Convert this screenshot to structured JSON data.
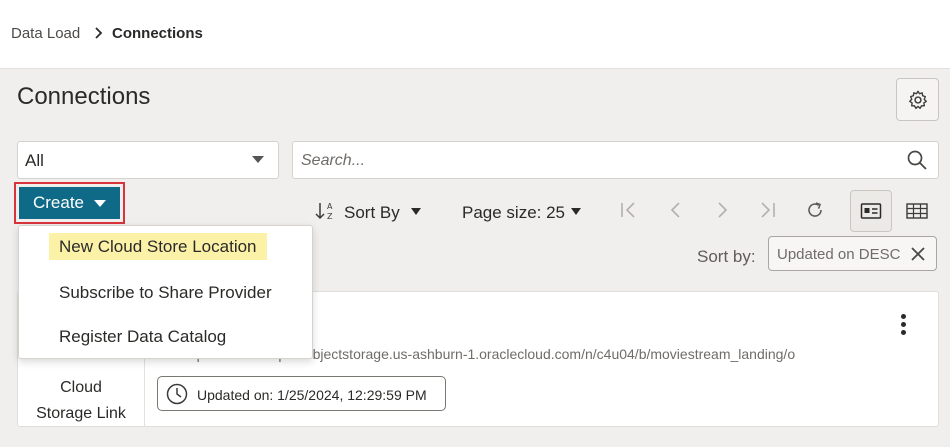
{
  "breadcrumb": {
    "parent": "Data Load",
    "current": "Connections"
  },
  "page": {
    "title": "Connections"
  },
  "filter": {
    "selected": "All"
  },
  "search": {
    "placeholder": "Search..."
  },
  "create": {
    "label": "Create",
    "menu": [
      "New Cloud Store Location",
      "Subscribe to Share Provider",
      "Register Data Catalog"
    ]
  },
  "toolbar": {
    "sort_label": "Sort By",
    "page_size_label": "Page size: 25"
  },
  "sort_chip": {
    "label": "Sort by:",
    "value": "Updated on DESC"
  },
  "card": {
    "type_line1": "Cloud",
    "type_line2": "Storage Link",
    "description_line": "Description      URI: https://objectstorage.us-ashburn-1.oraclecloud.com/n/c4u04/b/moviestream_landing/o",
    "updated": "Updated on: 1/25/2024, 12:29:59 PM"
  },
  "colors": {
    "accent": "#0e6a86",
    "highlight": "#fbf2a8",
    "outline": "#d9343b"
  }
}
